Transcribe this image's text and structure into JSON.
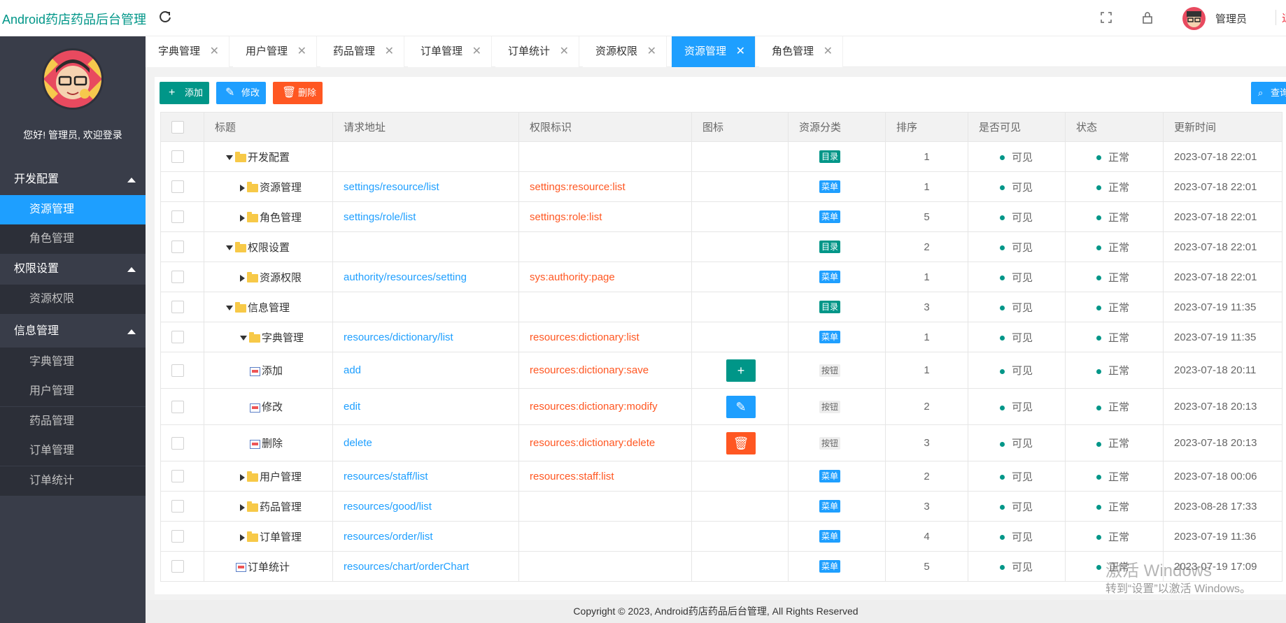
{
  "app": {
    "title": "Android药店药品后台管理",
    "user_name": "管理员",
    "exit_label": "退",
    "welcome": "您好! 管理员, 欢迎登录"
  },
  "sidebar": {
    "groups": [
      {
        "label": "开发配置",
        "items": [
          "资源管理",
          "角色管理"
        ]
      },
      {
        "label": "权限设置",
        "items": [
          "资源权限"
        ]
      },
      {
        "label": "信息管理",
        "items": [
          "字典管理",
          "用户管理",
          "药品管理",
          "订单管理",
          "订单统计"
        ]
      }
    ],
    "active_item": "资源管理"
  },
  "tabs": [
    "字典管理",
    "用户管理",
    "药品管理",
    "订单管理",
    "订单统计",
    "资源权限",
    "资源管理",
    "角色管理"
  ],
  "active_tab": "资源管理",
  "toolbar": {
    "add": "添加",
    "edit": "修改",
    "delete": "删除",
    "search": "查询"
  },
  "table": {
    "headers": [
      "标题",
      "请求地址",
      "权限标识",
      "图标",
      "资源分类",
      "排序",
      "是否可见",
      "状态",
      "更新时间"
    ],
    "rows": [
      {
        "title": "开发配置",
        "url": "",
        "perm": "",
        "icon": "",
        "category": "目录",
        "sort": "1",
        "visible": "可见",
        "status": "正常",
        "time": "2023-07-18 22:01"
      },
      {
        "title": "资源管理",
        "url": "settings/resource/list",
        "perm": "settings:resource:list",
        "icon": "",
        "category": "菜单",
        "sort": "1",
        "visible": "可见",
        "status": "正常",
        "time": "2023-07-18 22:01"
      },
      {
        "title": "角色管理",
        "url": "settings/role/list",
        "perm": "settings:role:list",
        "icon": "",
        "category": "菜单",
        "sort": "5",
        "visible": "可见",
        "status": "正常",
        "time": "2023-07-18 22:01"
      },
      {
        "title": "权限设置",
        "url": "",
        "perm": "",
        "icon": "",
        "category": "目录",
        "sort": "2",
        "visible": "可见",
        "status": "正常",
        "time": "2023-07-18 22:01"
      },
      {
        "title": "资源权限",
        "url": "authority/resources/setting",
        "perm": "sys:authority:page",
        "icon": "",
        "category": "菜单",
        "sort": "1",
        "visible": "可见",
        "status": "正常",
        "time": "2023-07-18 22:01"
      },
      {
        "title": "信息管理",
        "url": "",
        "perm": "",
        "icon": "",
        "category": "目录",
        "sort": "3",
        "visible": "可见",
        "status": "正常",
        "time": "2023-07-19 11:35"
      },
      {
        "title": "字典管理",
        "url": "resources/dictionary/list",
        "perm": "resources:dictionary:list",
        "icon": "",
        "category": "菜单",
        "sort": "1",
        "visible": "可见",
        "status": "正常",
        "time": "2023-07-19 11:35"
      },
      {
        "title": "添加",
        "url": "add",
        "perm": "resources:dictionary:save",
        "icon": "plus-icon",
        "category": "按钮",
        "sort": "1",
        "visible": "可见",
        "status": "正常",
        "time": "2023-07-18 20:11"
      },
      {
        "title": "修改",
        "url": "edit",
        "perm": "resources:dictionary:modify",
        "icon": "pencil-icon",
        "category": "按钮",
        "sort": "2",
        "visible": "可见",
        "status": "正常",
        "time": "2023-07-18 20:13"
      },
      {
        "title": "删除",
        "url": "delete",
        "perm": "resources:dictionary:delete",
        "icon": "trash-icon",
        "category": "按钮",
        "sort": "3",
        "visible": "可见",
        "status": "正常",
        "time": "2023-07-18 20:13"
      },
      {
        "title": "用户管理",
        "url": "resources/staff/list",
        "perm": "resources:staff:list",
        "icon": "",
        "category": "菜单",
        "sort": "2",
        "visible": "可见",
        "status": "正常",
        "time": "2023-07-18 00:06"
      },
      {
        "title": "药品管理",
        "url": "resources/good/list",
        "perm": "",
        "icon": "",
        "category": "菜单",
        "sort": "3",
        "visible": "可见",
        "status": "正常",
        "time": "2023-08-28 17:33"
      },
      {
        "title": "订单管理",
        "url": "resources/order/list",
        "perm": "",
        "icon": "",
        "category": "菜单",
        "sort": "4",
        "visible": "可见",
        "status": "正常",
        "time": "2023-07-19 11:36"
      },
      {
        "title": "订单统计",
        "url": "resources/chart/orderChart",
        "perm": "",
        "icon": "",
        "category": "菜单",
        "sort": "5",
        "visible": "可见",
        "status": "正常",
        "time": "2023-07-19 17:09"
      }
    ]
  },
  "footer": "Copyright © 2023, Android药店药品后台管理, All Rights Reserved",
  "watermark": {
    "line1": "激活 Windows",
    "line2": "转到“设置”以激活 Windows。"
  },
  "colors": {
    "primary": "#009688",
    "blue": "#1e9fff",
    "danger": "#ff5722",
    "sidebar": "#393d49"
  }
}
